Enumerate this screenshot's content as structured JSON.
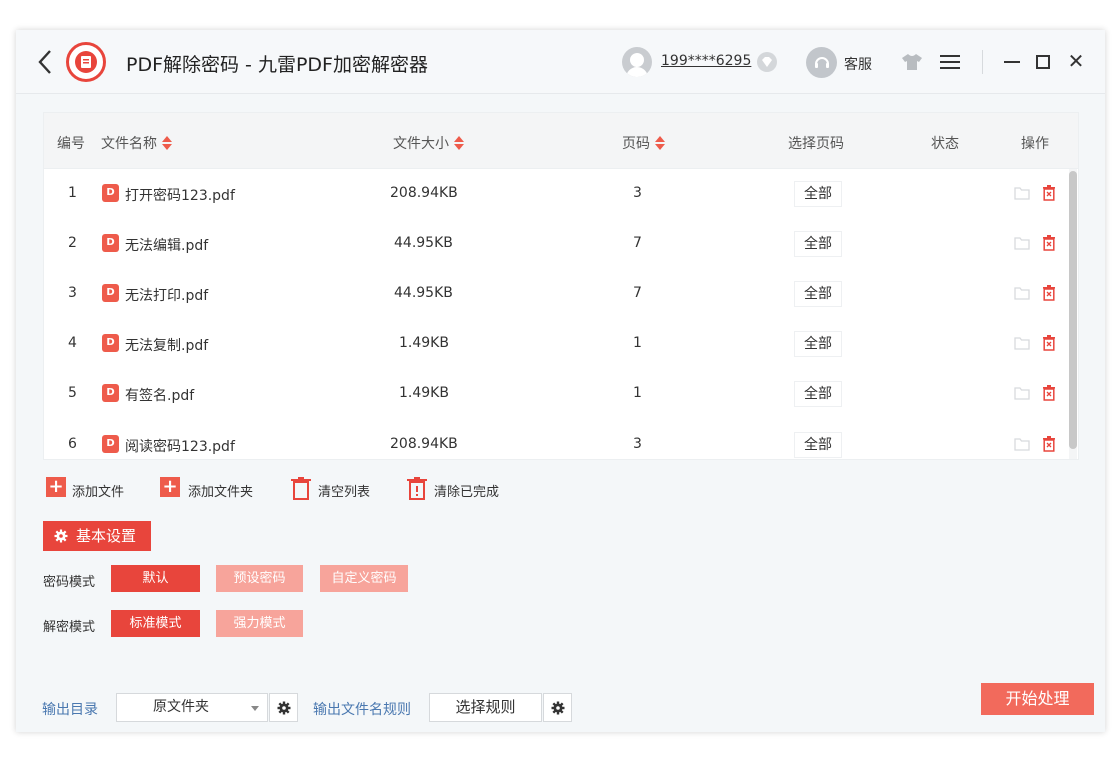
{
  "titlebar": {
    "title": "PDF解除密码 - 九雷PDF加密解密器",
    "user_name": "199****6295",
    "service_label": "客服",
    "icons": [
      "back-arrow-icon",
      "app-logo-icon",
      "user-avatar-icon",
      "vip-diamond-icon",
      "customer-service-icon",
      "skin-shirt-icon",
      "menu-icon",
      "minimize-icon",
      "maximize-icon",
      "close-icon"
    ]
  },
  "table": {
    "headers": {
      "index": "编号",
      "name": "文件名称",
      "size": "文件大小",
      "pages": "页码",
      "select_pages": "选择页码",
      "status": "状态",
      "actions": "操作"
    },
    "rows": [
      {
        "index": "1",
        "badge": "D",
        "name": "打开密码123.pdf",
        "size": "208.94KB",
        "pages": "3",
        "select": "全部",
        "status": ""
      },
      {
        "index": "2",
        "badge": "D",
        "name": "无法编辑.pdf",
        "size": "44.95KB",
        "pages": "7",
        "select": "全部",
        "status": ""
      },
      {
        "index": "3",
        "badge": "D",
        "name": "无法打印.pdf",
        "size": "44.95KB",
        "pages": "7",
        "select": "全部",
        "status": ""
      },
      {
        "index": "4",
        "badge": "D",
        "name": "无法复制.pdf",
        "size": "1.49KB",
        "pages": "1",
        "select": "全部",
        "status": ""
      },
      {
        "index": "5",
        "badge": "D",
        "name": "有签名.pdf",
        "size": "1.49KB",
        "pages": "1",
        "select": "全部",
        "status": ""
      },
      {
        "index": "6",
        "badge": "D",
        "name": "阅读密码123.pdf",
        "size": "208.94KB",
        "pages": "3",
        "select": "全部",
        "status": ""
      }
    ]
  },
  "toolbar": {
    "add_file": "添加文件",
    "add_folder": "添加文件夹",
    "clear_list": "清空列表",
    "clear_done": "清除已完成"
  },
  "settings": {
    "header": "基本设置",
    "password_mode_label": "密码模式",
    "password_modes": [
      "默认",
      "预设密码",
      "自定义密码"
    ],
    "password_mode_selected": "默认",
    "decrypt_mode_label": "解密模式",
    "decrypt_modes": [
      "标准模式",
      "强力模式"
    ],
    "decrypt_mode_selected": "标准模式"
  },
  "bottom": {
    "output_dir_label": "输出目录",
    "output_dir_value": "原文件夹",
    "output_name_label": "输出文件名规则",
    "rule_button": "选择规则",
    "start_button": "开始处理"
  },
  "colors": {
    "accent": "#e8453c",
    "accent_light": "#f7a49b",
    "start_button": "#f26a5c",
    "link_blue": "#4a78b0"
  }
}
